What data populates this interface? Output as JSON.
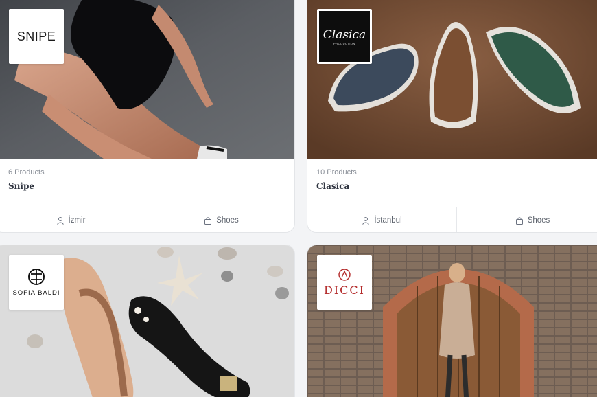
{
  "stores": [
    {
      "logo_text": "SNIPE",
      "products": "6 Products",
      "name": "Snipe",
      "location": "İzmir",
      "category": "Shoes"
    },
    {
      "logo_text": "Clasica",
      "logo_subtext": "PRODUCTION",
      "products": "10 Products",
      "name": "Clasica",
      "location": "İstanbul",
      "category": "Shoes"
    },
    {
      "logo_text": "SOFIA BALDI"
    },
    {
      "logo_text": "DICCI"
    }
  ],
  "colors": {
    "card_bg": "#ffffff",
    "page_bg": "#f3f4f6",
    "text_muted": "#8a8f98",
    "text_title": "#2f3440"
  },
  "icons": {
    "location": "user-pin-icon",
    "category": "shopping-bag-icon"
  }
}
